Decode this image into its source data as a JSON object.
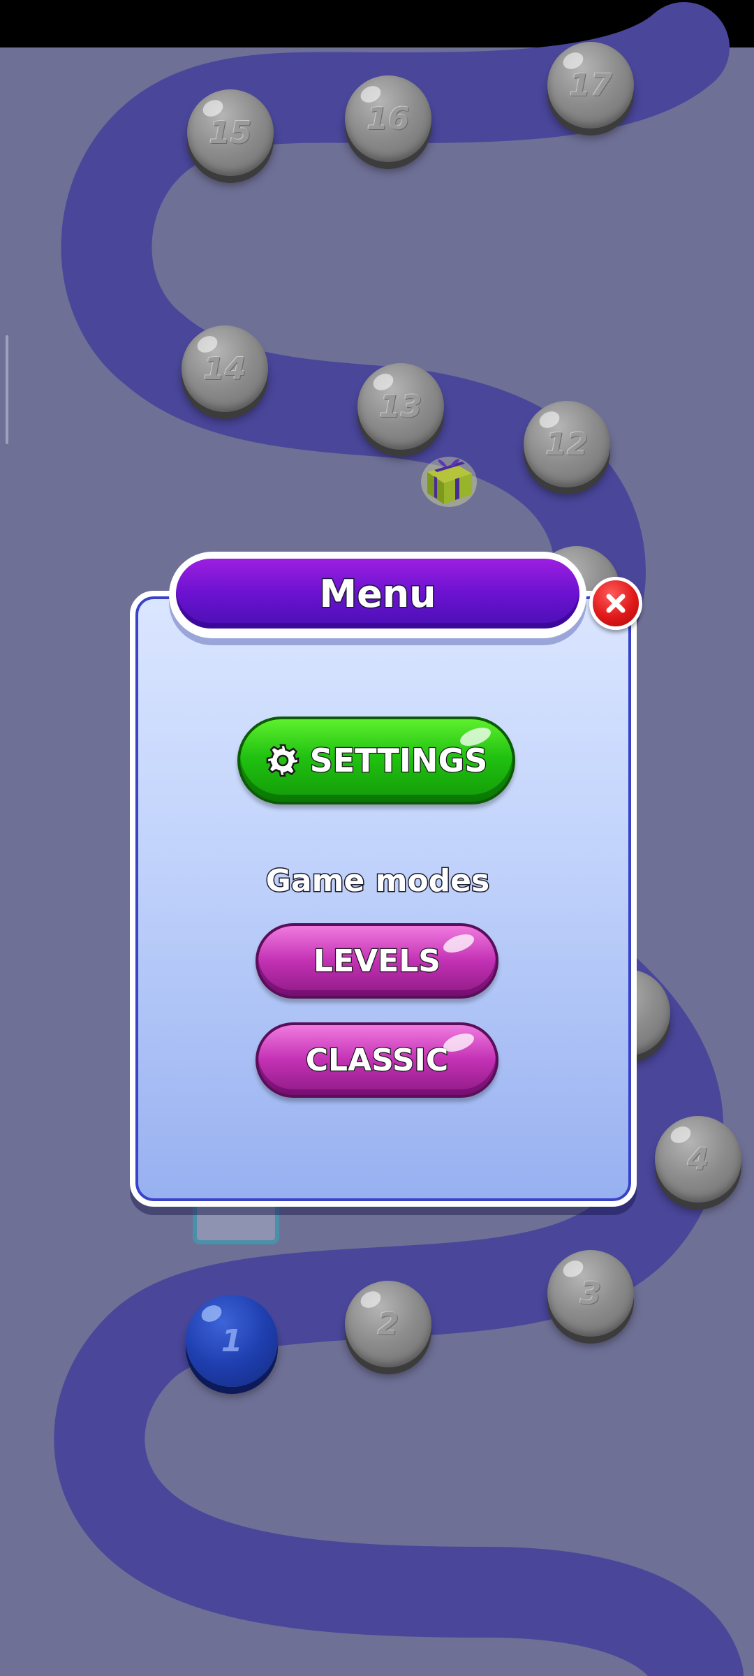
{
  "map": {
    "levels": [
      {
        "number": "15",
        "state": "locked"
      },
      {
        "number": "16",
        "state": "locked"
      },
      {
        "number": "17",
        "state": "locked"
      },
      {
        "number": "14",
        "state": "locked"
      },
      {
        "number": "13",
        "state": "locked"
      },
      {
        "number": "12",
        "state": "locked"
      },
      {
        "number": "4",
        "state": "locked"
      },
      {
        "number": "3",
        "state": "locked"
      },
      {
        "number": "2",
        "state": "locked"
      },
      {
        "number": "1",
        "state": "current"
      }
    ],
    "path_color": "#4a469a",
    "background_color": "#6f7096"
  },
  "menu": {
    "title": "Menu",
    "settings_label": "SETTINGS",
    "game_modes_label": "Game modes",
    "levels_label": "LEVELS",
    "classic_label": "CLASSIC"
  },
  "colors": {
    "settings_button": "#21c211",
    "mode_button": "#c331b4",
    "title_bar": "#6b12d0",
    "close_button": "#e01818"
  }
}
